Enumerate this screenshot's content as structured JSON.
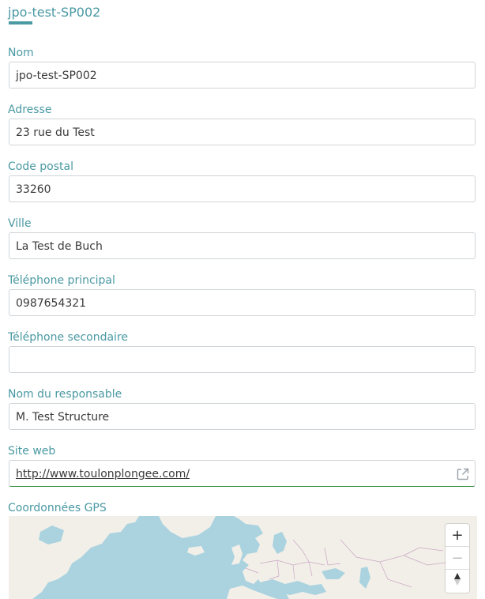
{
  "header": {
    "title": "jpo-test-SP002"
  },
  "fields": [
    {
      "label": "Nom",
      "value": "jpo-test-SP002"
    },
    {
      "label": "Adresse",
      "value": "23 rue du Test"
    },
    {
      "label": "Code postal",
      "value": "33260"
    },
    {
      "label": "Ville",
      "value": "La Test de Buch"
    },
    {
      "label": "Téléphone principal",
      "value": "0987654321"
    },
    {
      "label": "Téléphone secondaire",
      "value": ""
    },
    {
      "label": "Nom du responsable",
      "value": "M. Test Structure"
    },
    {
      "label": "Site web",
      "value": "http://www.toulonplongee.com/"
    }
  ],
  "gps": {
    "label": "Coordonnées GPS"
  },
  "map_controls": {
    "zoom_in": "+",
    "zoom_out": "−",
    "reset_north": "▲"
  },
  "colors": {
    "accent": "#4a99a3",
    "border": "#cfd4d8",
    "url_underline": "#2c8a3a",
    "water": "#aad3df",
    "land": "#f2efe9"
  },
  "icons": {
    "external_link": "external-link-icon",
    "compass": "compass-icon"
  }
}
